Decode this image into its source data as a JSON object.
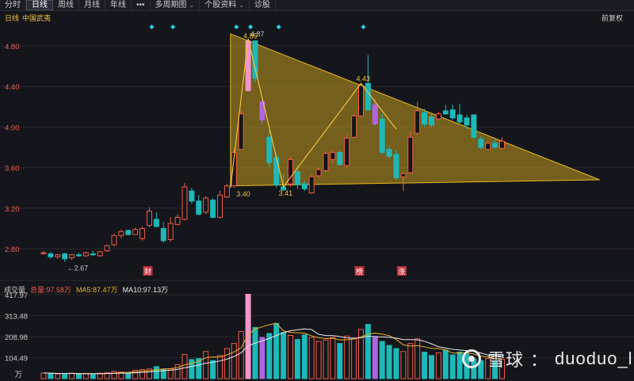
{
  "toolbar": {
    "tabs": [
      "分时",
      "日线",
      "周线",
      "月线",
      "年线"
    ],
    "more": "•••",
    "multi_period": "多周期图",
    "stock_info": "个股资料",
    "diagnose": "诊股"
  },
  "header": {
    "period": "日线",
    "stock": "中国武夷",
    "adjust": "前复权"
  },
  "volume_header": {
    "title": "成交量",
    "total": "总量:97.58万",
    "ma5": "MA5:87.47万",
    "ma10": "MA10:97.13万"
  },
  "watermark": {
    "brand": "雪球",
    "sep": "：",
    "user": "duoduo_l"
  },
  "colors": {
    "up": "#f05a4a",
    "down": "#1fb8b8",
    "special": "#b065e0",
    "limit_up": "#f596c8",
    "triangle": "#e8b820",
    "ma5": "#f0b020",
    "ma10": "#e8e8ea",
    "marker": "#2ad0e8"
  },
  "chart_data": [
    {
      "type": "candlestick",
      "title": "",
      "ylim": [
        2.55,
        4.98
      ],
      "yticks": [
        2.8,
        3.2,
        3.6,
        4.0,
        4.4,
        4.8
      ],
      "ytick_labels": [
        "2.80",
        "3.20",
        "3.60",
        "4.00",
        "4.40",
        "4.80"
      ],
      "candles": [
        {
          "o": 2.76,
          "h": 2.78,
          "l": 2.74,
          "c": 2.76,
          "k": "up"
        },
        {
          "o": 2.75,
          "h": 2.77,
          "l": 2.7,
          "c": 2.72,
          "k": "down"
        },
        {
          "o": 2.72,
          "h": 2.75,
          "l": 2.7,
          "c": 2.74,
          "k": "up"
        },
        {
          "o": 2.75,
          "h": 2.76,
          "l": 2.67,
          "c": 2.7,
          "k": "down"
        },
        {
          "o": 2.71,
          "h": 2.75,
          "l": 2.69,
          "c": 2.74,
          "k": "up"
        },
        {
          "o": 2.74,
          "h": 2.76,
          "l": 2.72,
          "c": 2.73,
          "k": "down"
        },
        {
          "o": 2.73,
          "h": 2.77,
          "l": 2.72,
          "c": 2.76,
          "k": "up"
        },
        {
          "o": 2.75,
          "h": 2.78,
          "l": 2.73,
          "c": 2.74,
          "k": "down"
        },
        {
          "o": 2.73,
          "h": 2.78,
          "l": 2.72,
          "c": 2.77,
          "k": "up"
        },
        {
          "o": 2.78,
          "h": 2.84,
          "l": 2.77,
          "c": 2.83,
          "k": "up"
        },
        {
          "o": 2.84,
          "h": 2.95,
          "l": 2.82,
          "c": 2.93,
          "k": "up"
        },
        {
          "o": 2.93,
          "h": 2.99,
          "l": 2.9,
          "c": 2.97,
          "k": "up"
        },
        {
          "o": 2.98,
          "h": 2.99,
          "l": 2.93,
          "c": 2.94,
          "k": "down"
        },
        {
          "o": 2.94,
          "h": 3.01,
          "l": 2.94,
          "c": 2.99,
          "k": "up"
        },
        {
          "o": 2.9,
          "h": 3.02,
          "l": 2.88,
          "c": 3.0,
          "k": "up"
        },
        {
          "o": 3.03,
          "h": 3.21,
          "l": 3.01,
          "c": 3.17,
          "k": "up"
        },
        {
          "o": 3.09,
          "h": 3.16,
          "l": 3.01,
          "c": 3.02,
          "k": "down"
        },
        {
          "o": 3.0,
          "h": 3.06,
          "l": 2.86,
          "c": 2.88,
          "k": "down"
        },
        {
          "o": 2.89,
          "h": 3.11,
          "l": 2.87,
          "c": 3.05,
          "k": "up"
        },
        {
          "o": 3.04,
          "h": 3.14,
          "l": 3.03,
          "c": 3.11,
          "k": "up"
        },
        {
          "o": 3.09,
          "h": 3.45,
          "l": 3.08,
          "c": 3.41,
          "k": "up"
        },
        {
          "o": 3.37,
          "h": 3.4,
          "l": 3.24,
          "c": 3.27,
          "k": "down"
        },
        {
          "o": 3.27,
          "h": 3.33,
          "l": 3.13,
          "c": 3.14,
          "k": "down"
        },
        {
          "o": 3.16,
          "h": 3.32,
          "l": 3.14,
          "c": 3.3,
          "k": "up"
        },
        {
          "o": 3.28,
          "h": 3.3,
          "l": 3.1,
          "c": 3.11,
          "k": "down"
        },
        {
          "o": 3.11,
          "h": 3.37,
          "l": 3.1,
          "c": 3.33,
          "k": "up"
        },
        {
          "o": 3.31,
          "h": 3.44,
          "l": 3.3,
          "c": 3.42,
          "k": "up"
        },
        {
          "o": 3.42,
          "h": 3.79,
          "l": 3.4,
          "c": 3.75,
          "k": "up"
        },
        {
          "o": 3.78,
          "h": 4.17,
          "l": 3.78,
          "c": 4.13,
          "k": "up"
        },
        {
          "o": 4.36,
          "h": 4.87,
          "l": 4.35,
          "c": 4.85,
          "k": "limit"
        },
        {
          "o": 4.85,
          "h": 4.85,
          "l": 4.44,
          "c": 4.48,
          "k": "down"
        },
        {
          "o": 4.25,
          "h": 4.29,
          "l": 4.03,
          "c": 4.07,
          "k": "special"
        },
        {
          "o": 3.9,
          "h": 3.97,
          "l": 3.6,
          "c": 3.65,
          "k": "down"
        },
        {
          "o": 3.7,
          "h": 3.74,
          "l": 3.4,
          "c": 3.43,
          "k": "down"
        },
        {
          "o": 3.38,
          "h": 3.54,
          "l": 3.37,
          "c": 3.41,
          "k": "down"
        },
        {
          "o": 3.44,
          "h": 3.71,
          "l": 3.41,
          "c": 3.68,
          "k": "up"
        },
        {
          "o": 3.56,
          "h": 3.62,
          "l": 3.39,
          "c": 3.43,
          "k": "down"
        },
        {
          "o": 3.44,
          "h": 3.47,
          "l": 3.37,
          "c": 3.39,
          "k": "down"
        },
        {
          "o": 3.35,
          "h": 3.53,
          "l": 3.34,
          "c": 3.51,
          "k": "up"
        },
        {
          "o": 3.52,
          "h": 3.6,
          "l": 3.5,
          "c": 3.58,
          "k": "up"
        },
        {
          "o": 3.57,
          "h": 3.76,
          "l": 3.55,
          "c": 3.74,
          "k": "up"
        },
        {
          "o": 3.68,
          "h": 3.77,
          "l": 3.64,
          "c": 3.75,
          "k": "up"
        },
        {
          "o": 3.75,
          "h": 3.77,
          "l": 3.62,
          "c": 3.63,
          "k": "down"
        },
        {
          "o": 3.62,
          "h": 3.93,
          "l": 3.6,
          "c": 3.89,
          "k": "up"
        },
        {
          "o": 3.9,
          "h": 4.13,
          "l": 3.89,
          "c": 4.11,
          "k": "up"
        },
        {
          "o": 4.11,
          "h": 4.42,
          "l": 4.1,
          "c": 4.41,
          "k": "up"
        },
        {
          "o": 4.43,
          "h": 4.71,
          "l": 4.16,
          "c": 4.17,
          "k": "down"
        },
        {
          "o": 4.22,
          "h": 4.28,
          "l": 4.01,
          "c": 4.03,
          "k": "special"
        },
        {
          "o": 4.08,
          "h": 4.13,
          "l": 3.73,
          "c": 3.75,
          "k": "down"
        },
        {
          "o": 3.78,
          "h": 3.82,
          "l": 3.69,
          "c": 3.71,
          "k": "down"
        },
        {
          "o": 3.73,
          "h": 3.77,
          "l": 3.48,
          "c": 3.5,
          "k": "down"
        },
        {
          "o": 3.51,
          "h": 3.55,
          "l": 3.37,
          "c": 3.54,
          "k": "up"
        },
        {
          "o": 3.55,
          "h": 3.96,
          "l": 3.53,
          "c": 3.9,
          "k": "up"
        },
        {
          "o": 3.94,
          "h": 4.25,
          "l": 3.92,
          "c": 4.16,
          "k": "up"
        },
        {
          "o": 4.14,
          "h": 4.18,
          "l": 4.0,
          "c": 4.03,
          "k": "down"
        },
        {
          "o": 4.1,
          "h": 4.14,
          "l": 4.0,
          "c": 4.02,
          "k": "down"
        },
        {
          "o": 4.08,
          "h": 4.15,
          "l": 4.07,
          "c": 4.13,
          "k": "up"
        },
        {
          "o": 4.16,
          "h": 4.22,
          "l": 4.12,
          "c": 4.13,
          "k": "down"
        },
        {
          "o": 4.17,
          "h": 4.22,
          "l": 4.07,
          "c": 4.09,
          "k": "down"
        },
        {
          "o": 4.12,
          "h": 4.23,
          "l": 4.03,
          "c": 4.05,
          "k": "down"
        },
        {
          "o": 4.09,
          "h": 4.12,
          "l": 3.98,
          "c": 4.02,
          "k": "down"
        },
        {
          "o": 4.12,
          "h": 4.12,
          "l": 3.87,
          "c": 3.9,
          "k": "down"
        },
        {
          "o": 3.88,
          "h": 3.91,
          "l": 3.78,
          "c": 3.8,
          "k": "down"
        },
        {
          "o": 3.78,
          "h": 3.86,
          "l": 3.77,
          "c": 3.84,
          "k": "up"
        },
        {
          "o": 3.84,
          "h": 3.88,
          "l": 3.79,
          "c": 3.8,
          "k": "down"
        },
        {
          "o": 3.79,
          "h": 3.9,
          "l": 3.77,
          "c": 3.86,
          "k": "up"
        }
      ],
      "triangle": {
        "top": [
          0,
          4.92
        ],
        "bottom": [
          0,
          3.42
        ],
        "apex": [
          69.3,
          3.48
        ]
      },
      "zigzag": [
        [
          0,
          3.4
        ],
        [
          29,
          4.87
        ],
        [
          34,
          3.41
        ],
        [
          45,
          4.43
        ],
        [
          50,
          3.98
        ]
      ],
      "annotations": [
        {
          "i": 29,
          "p": 4.85,
          "text": "4.85",
          "color": "#f0c040"
        },
        {
          "i": 30,
          "p": 4.87,
          "text": "4.87",
          "color": "#c8c8cc"
        },
        {
          "i": 28,
          "p": 3.4,
          "text": "3.40",
          "color": "#f0c040"
        },
        {
          "i": 34,
          "p": 3.41,
          "text": "3.41",
          "color": "#f0c040"
        },
        {
          "i": 45,
          "p": 4.43,
          "text": "4.43",
          "color": "#f0c040"
        },
        {
          "i": 4,
          "p": 2.67,
          "text": "←2.67",
          "color": "#c8c8cc"
        }
      ],
      "markers_top": [
        15,
        18,
        27,
        29,
        33,
        45
      ],
      "event_labels": [
        {
          "i": 15,
          "text": "财"
        },
        {
          "i": 45,
          "text": "榜"
        },
        {
          "i": 51,
          "text": "涨"
        }
      ]
    },
    {
      "type": "bar",
      "title": "",
      "unit": "万",
      "ylim": [
        0,
        417.97
      ],
      "ytick_labels": [
        "417.97",
        "313.48",
        "208.98",
        "104.49"
      ],
      "yticks": [
        417.97,
        313.48,
        208.98,
        104.49
      ],
      "values": [
        28,
        26,
        23,
        25,
        27,
        22,
        25,
        21,
        27,
        30,
        36,
        33,
        30,
        42,
        45,
        48,
        60,
        47,
        48,
        70,
        120,
        95,
        100,
        135,
        90,
        115,
        150,
        175,
        235,
        420,
        255,
        205,
        225,
        275,
        230,
        215,
        195,
        218,
        205,
        185,
        192,
        205,
        175,
        212,
        202,
        245,
        270,
        205,
        185,
        165,
        150,
        135,
        175,
        198,
        132,
        115,
        128,
        142,
        118,
        132,
        122,
        98,
        90,
        100,
        87,
        97
      ],
      "kinds": [
        "up",
        "down",
        "up",
        "down",
        "up",
        "down",
        "up",
        "down",
        "up",
        "up",
        "up",
        "up",
        "down",
        "up",
        "up",
        "up",
        "down",
        "down",
        "up",
        "up",
        "up",
        "down",
        "down",
        "up",
        "down",
        "up",
        "up",
        "up",
        "up",
        "limit",
        "down",
        "special",
        "down",
        "down",
        "down",
        "up",
        "down",
        "down",
        "up",
        "up",
        "up",
        "up",
        "down",
        "up",
        "up",
        "up",
        "down",
        "special",
        "down",
        "down",
        "down",
        "up",
        "up",
        "up",
        "down",
        "down",
        "up",
        "down",
        "down",
        "down",
        "down",
        "down",
        "down",
        "up",
        "down",
        "up"
      ]
    }
  ]
}
